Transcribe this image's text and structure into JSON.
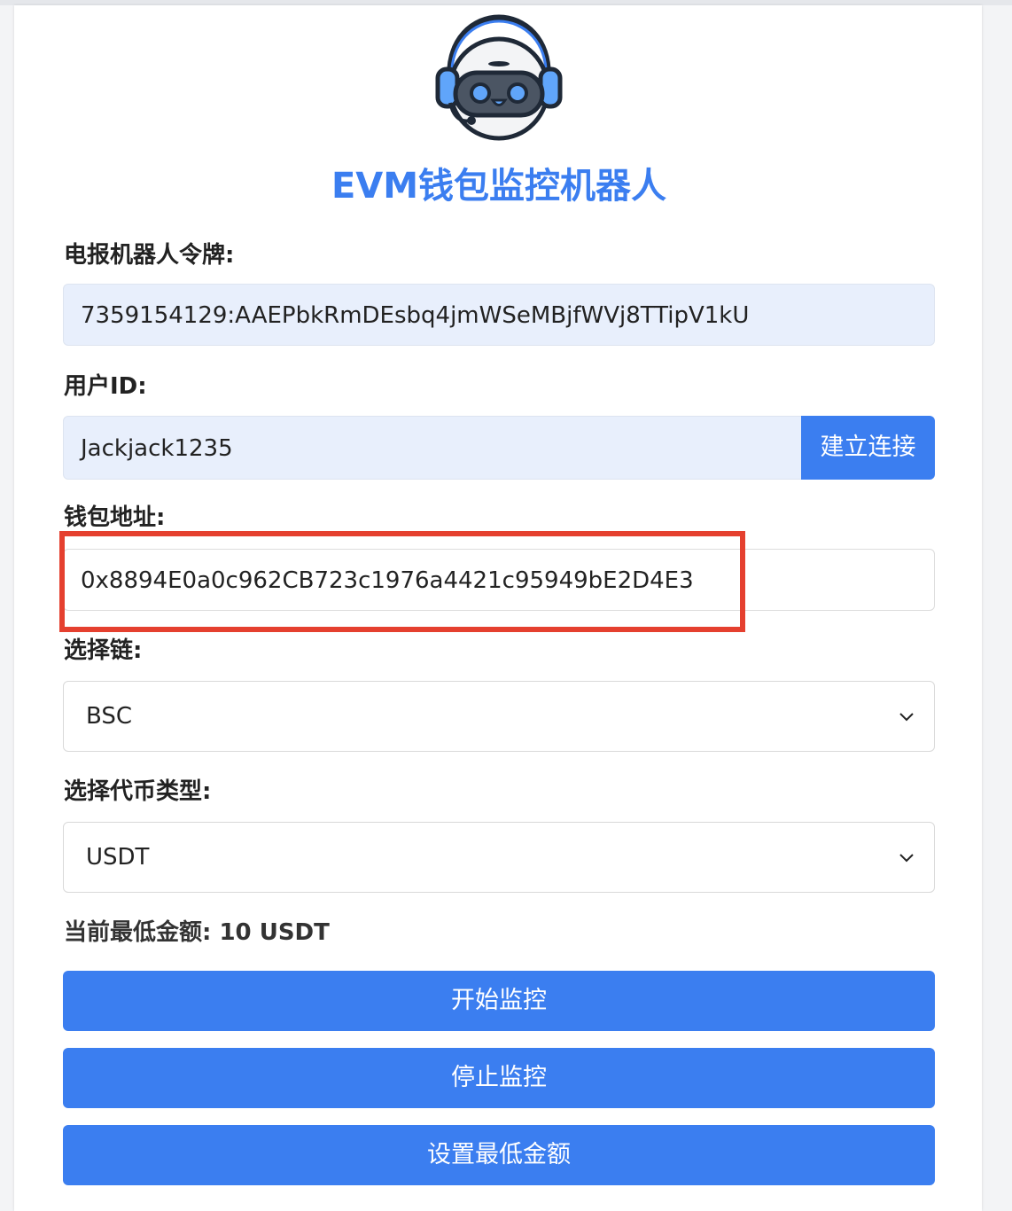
{
  "app": {
    "title": "EVM钱包监控机器人",
    "logo_icon": "robot-headset-icon",
    "accent_color": "#3b7ef0",
    "highlight_color": "#e5402f"
  },
  "form": {
    "token_label": "电报机器人令牌:",
    "token_value": "7359154129:AAEPbkRmDEsbq4jmWSeMBjfWVj8TTipV1kU",
    "user_id_label": "用户ID:",
    "user_id_value": "Jackjack1235",
    "connect_button": "建立连接",
    "wallet_label": "钱包地址:",
    "wallet_value": "0x8894E0a0c962CB723c1976a4421c95949bE2D4E3",
    "chain_label": "选择链:",
    "chain_selected": "BSC",
    "token_type_label": "选择代币类型:",
    "token_type_selected": "USDT",
    "min_amount_label": "当前最低金额:",
    "min_amount_value": "10 USDT"
  },
  "actions": {
    "start": "开始监控",
    "stop": "停止监控",
    "set_min": "设置最低金额"
  }
}
